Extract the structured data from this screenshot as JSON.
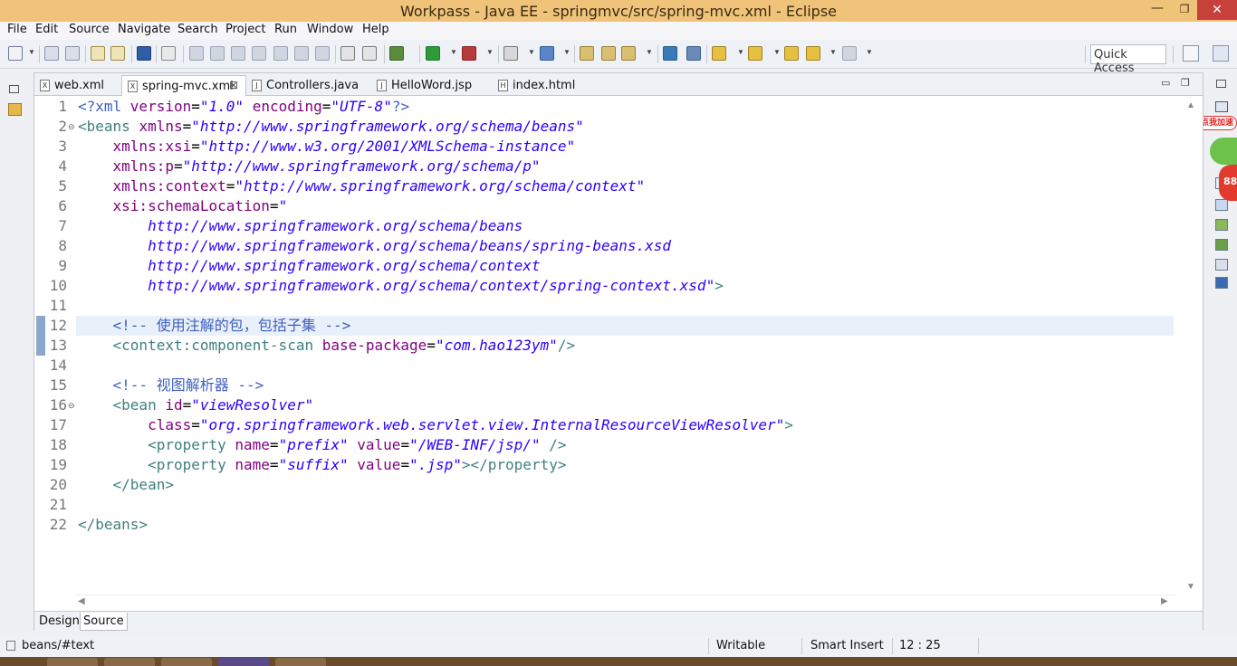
{
  "window": {
    "title": "Workpass - Java EE - springmvc/src/spring-mvc.xml - Eclipse",
    "minimize_glyph": "—",
    "maximize_glyph": "❐",
    "close_glyph": "✕"
  },
  "menu": [
    "File",
    "Edit",
    "Source",
    "Navigate",
    "Search",
    "Project",
    "Run",
    "Window",
    "Help"
  ],
  "toolbar": {
    "quick_access": "Quick Access"
  },
  "tabs": [
    {
      "label": "web.xml",
      "icon": "X",
      "active": false
    },
    {
      "label": "spring-mvc.xml",
      "icon": "X",
      "active": true,
      "close": "⊠"
    },
    {
      "label": "Controllers.java",
      "icon": "J",
      "active": false
    },
    {
      "label": "HelloWord.jsp",
      "icon": "J",
      "active": false
    },
    {
      "label": "index.html",
      "icon": "H",
      "active": false
    }
  ],
  "editor": {
    "current_line": 12,
    "lines": [
      {
        "n": "1",
        "fold": "",
        "segs": [
          [
            "t-pi",
            "<?xml "
          ],
          [
            "t-attr",
            "version"
          ],
          [
            "t-txt",
            "="
          ],
          [
            "t-val",
            "\"1.0\""
          ],
          [
            "t-txt",
            " "
          ],
          [
            "t-attr",
            "encoding"
          ],
          [
            "t-txt",
            "="
          ],
          [
            "t-val",
            "\"UTF-8\""
          ],
          [
            "t-pi",
            "?>"
          ]
        ]
      },
      {
        "n": "2",
        "fold": "⊖",
        "segs": [
          [
            "t-tag",
            "<beans "
          ],
          [
            "t-attr",
            "xmlns"
          ],
          [
            "t-txt",
            "="
          ],
          [
            "t-val",
            "\"http://www.springframework.org/schema/beans\""
          ]
        ]
      },
      {
        "n": "3",
        "fold": "",
        "segs": [
          [
            "t-txt",
            "    "
          ],
          [
            "t-attr",
            "xmlns:xsi"
          ],
          [
            "t-txt",
            "="
          ],
          [
            "t-val",
            "\"http://www.w3.org/2001/XMLSchema-instance\""
          ]
        ]
      },
      {
        "n": "4",
        "fold": "",
        "segs": [
          [
            "t-txt",
            "    "
          ],
          [
            "t-attr",
            "xmlns:p"
          ],
          [
            "t-txt",
            "="
          ],
          [
            "t-val",
            "\"http://www.springframework.org/schema/p\""
          ]
        ]
      },
      {
        "n": "5",
        "fold": "",
        "segs": [
          [
            "t-txt",
            "    "
          ],
          [
            "t-attr",
            "xmlns:context"
          ],
          [
            "t-txt",
            "="
          ],
          [
            "t-val",
            "\"http://www.springframework.org/schema/context\""
          ]
        ]
      },
      {
        "n": "6",
        "fold": "",
        "segs": [
          [
            "t-txt",
            "    "
          ],
          [
            "t-attr",
            "xsi:schemaLocation"
          ],
          [
            "t-txt",
            "="
          ],
          [
            "t-val",
            "\""
          ]
        ]
      },
      {
        "n": "7",
        "fold": "",
        "segs": [
          [
            "t-txt",
            "        "
          ],
          [
            "t-val",
            "http://www.springframework.org/schema/beans"
          ]
        ]
      },
      {
        "n": "8",
        "fold": "",
        "segs": [
          [
            "t-txt",
            "        "
          ],
          [
            "t-val",
            "http://www.springframework.org/schema/beans/spring-beans.xsd"
          ]
        ]
      },
      {
        "n": "9",
        "fold": "",
        "segs": [
          [
            "t-txt",
            "        "
          ],
          [
            "t-val",
            "http://www.springframework.org/schema/context"
          ]
        ]
      },
      {
        "n": "10",
        "fold": "",
        "segs": [
          [
            "t-txt",
            "        "
          ],
          [
            "t-val",
            "http://www.springframework.org/schema/context/spring-context.xsd\""
          ],
          [
            "t-tag",
            ">"
          ]
        ]
      },
      {
        "n": "11",
        "fold": "",
        "segs": []
      },
      {
        "n": "12",
        "fold": "",
        "segs": [
          [
            "t-txt",
            "    "
          ],
          [
            "t-com",
            "<!-- 使用注解的包，包括子集 -->"
          ]
        ]
      },
      {
        "n": "13",
        "fold": "",
        "segs": [
          [
            "t-txt",
            "    "
          ],
          [
            "t-tag",
            "<context:component-scan "
          ],
          [
            "t-attr",
            "base-package"
          ],
          [
            "t-txt",
            "="
          ],
          [
            "t-val",
            "\"com.hao123ym\""
          ],
          [
            "t-tag",
            "/>"
          ]
        ]
      },
      {
        "n": "14",
        "fold": "",
        "segs": []
      },
      {
        "n": "15",
        "fold": "",
        "segs": [
          [
            "t-txt",
            "    "
          ],
          [
            "t-com",
            "<!-- 视图解析器 -->"
          ]
        ]
      },
      {
        "n": "16",
        "fold": "⊖",
        "segs": [
          [
            "t-txt",
            "    "
          ],
          [
            "t-tag",
            "<bean "
          ],
          [
            "t-attr",
            "id"
          ],
          [
            "t-txt",
            "="
          ],
          [
            "t-val",
            "\"viewResolver\""
          ]
        ]
      },
      {
        "n": "17",
        "fold": "",
        "segs": [
          [
            "t-txt",
            "        "
          ],
          [
            "t-attr",
            "class"
          ],
          [
            "t-txt",
            "="
          ],
          [
            "t-val",
            "\"org.springframework.web.servlet.view.InternalResourceViewResolver\""
          ],
          [
            "t-tag",
            ">"
          ]
        ]
      },
      {
        "n": "18",
        "fold": "",
        "segs": [
          [
            "t-txt",
            "        "
          ],
          [
            "t-tag",
            "<property "
          ],
          [
            "t-attr",
            "name"
          ],
          [
            "t-txt",
            "="
          ],
          [
            "t-val",
            "\"prefix\""
          ],
          [
            "t-txt",
            " "
          ],
          [
            "t-attr",
            "value"
          ],
          [
            "t-txt",
            "="
          ],
          [
            "t-val",
            "\"/WEB-INF/jsp/\""
          ],
          [
            "t-txt",
            " "
          ],
          [
            "t-tag",
            "/>"
          ]
        ]
      },
      {
        "n": "19",
        "fold": "",
        "segs": [
          [
            "t-txt",
            "        "
          ],
          [
            "t-tag",
            "<property "
          ],
          [
            "t-attr",
            "name"
          ],
          [
            "t-txt",
            "="
          ],
          [
            "t-val",
            "\"suffix\""
          ],
          [
            "t-txt",
            " "
          ],
          [
            "t-attr",
            "value"
          ],
          [
            "t-txt",
            "="
          ],
          [
            "t-val",
            "\".jsp\""
          ],
          [
            "t-tag",
            "></property>"
          ]
        ]
      },
      {
        "n": "20",
        "fold": "",
        "segs": [
          [
            "t-txt",
            "    "
          ],
          [
            "t-tag",
            "</bean>"
          ]
        ]
      },
      {
        "n": "21",
        "fold": "",
        "segs": []
      },
      {
        "n": "22",
        "fold": "",
        "segs": [
          [
            "t-tag",
            "</beans>"
          ]
        ]
      }
    ]
  },
  "page_tabs": [
    {
      "label": "Design",
      "active": false
    },
    {
      "label": "Source",
      "active": true
    }
  ],
  "status": {
    "path": "beans/#text",
    "writable": "Writable",
    "insert_mode": "Smart Insert",
    "position": "12 : 25"
  },
  "overlay": {
    "badge": "点我加速",
    "ball": "88"
  },
  "colors": {
    "titlebar": "#f0c37a",
    "tag": "#3f7f7f",
    "attr": "#7f007f",
    "value": "#2a00ff",
    "comment": "#3f5fbf",
    "current_line": "#e8f0fa"
  }
}
